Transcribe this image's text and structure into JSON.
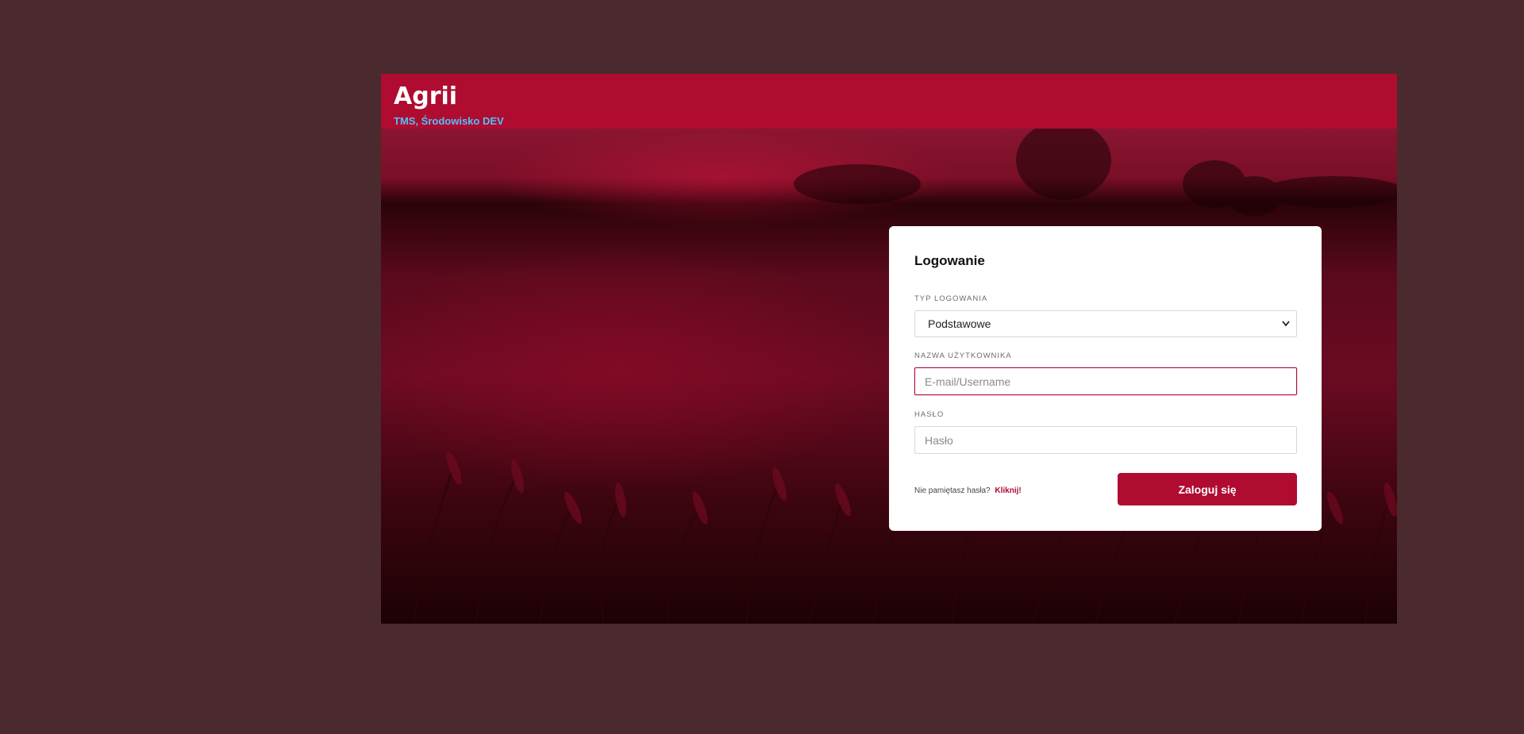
{
  "header": {
    "logo_text": "Agrii",
    "subtitle": "TMS, Środowisko DEV"
  },
  "login_card": {
    "title": "Logowanie",
    "login_type": {
      "label": "TYP LOGOWANIA",
      "selected": "Podstawowe"
    },
    "username": {
      "label": "NAZWA UŻYTKOWNIKA",
      "placeholder": "E-mail/Username",
      "value": ""
    },
    "password": {
      "label": "HASŁO",
      "placeholder": "Hasło",
      "value": ""
    },
    "forgot_text": "Nie pamiętasz hasła?",
    "forgot_link": "Kliknij!",
    "submit_label": "Zaloguj się"
  },
  "colors": {
    "brand": "#b00b31",
    "subtitle": "#4fc3f7",
    "page_background": "#4a2a2e"
  },
  "icons": {
    "select_arrow": "chevron-down-icon"
  }
}
